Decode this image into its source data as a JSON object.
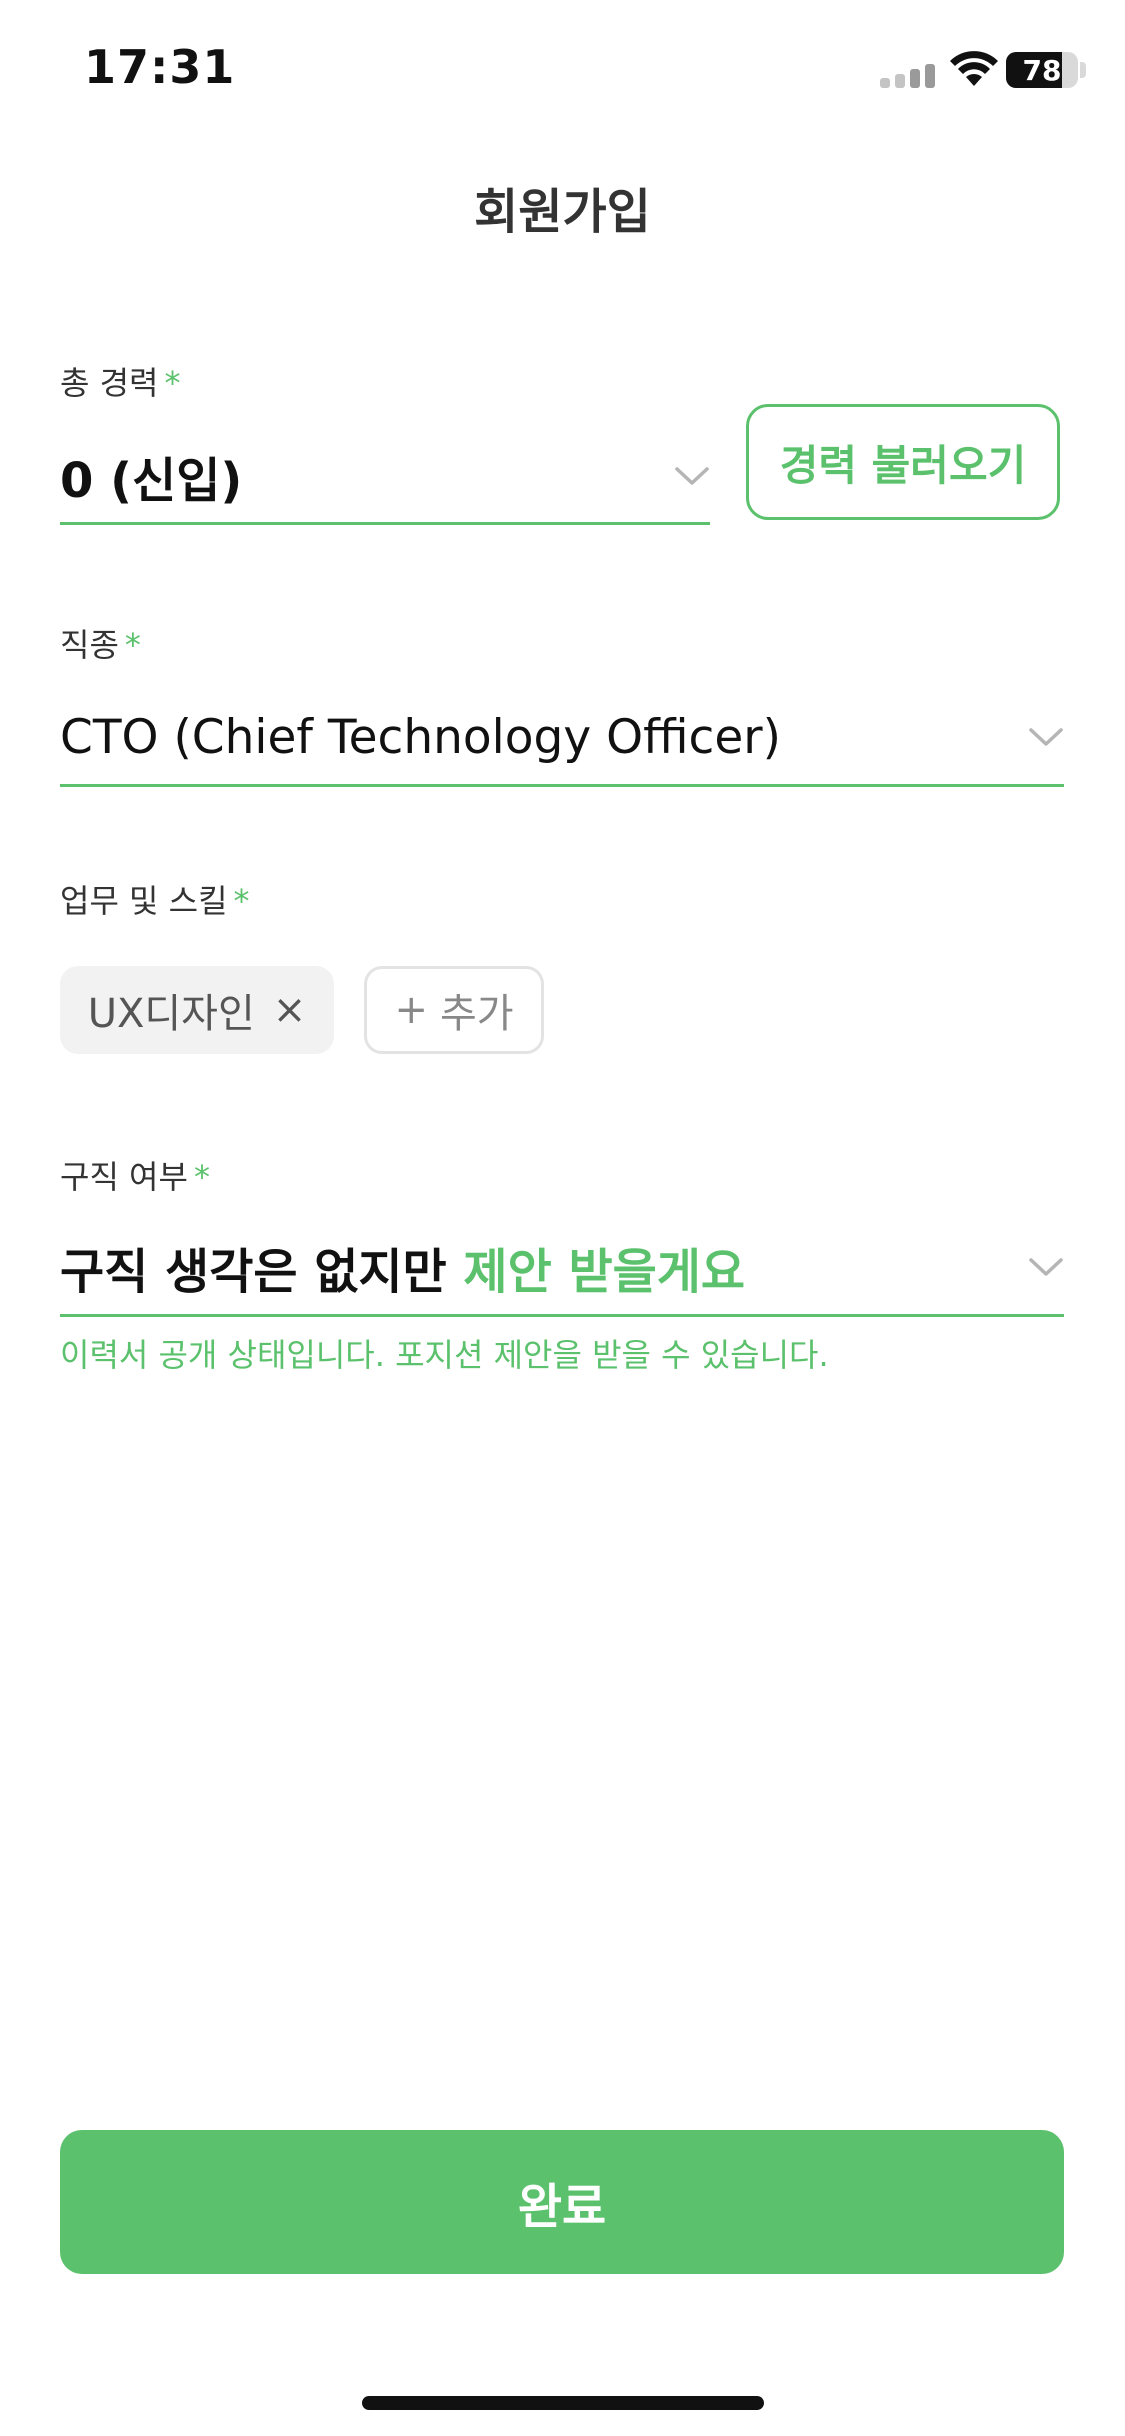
{
  "status_bar": {
    "time": "17:31",
    "battery_level": "78"
  },
  "header": {
    "title": "회원가입"
  },
  "form": {
    "career": {
      "label": "총 경력",
      "required_mark": "*",
      "value": "0 (신입)",
      "load_button": "경력 불러오기"
    },
    "job": {
      "label": "직종",
      "required_mark": "*",
      "value": "CTO (Chief Technology Officer)"
    },
    "skills": {
      "label": "업무 및 스킬",
      "required_mark": "*",
      "chips": [
        "UX디자인"
      ],
      "chip_remove": "×",
      "add_icon": "+",
      "add_label": "추가"
    },
    "job_seeking": {
      "label": "구직 여부",
      "required_mark": "*",
      "value_prefix": "구직 생각은 없지만 ",
      "value_highlight": "제안 받을게요",
      "helper": "이력서 공개 상태입니다. 포지션 제안을 받을 수 있습니다."
    }
  },
  "footer": {
    "submit_label": "완료"
  },
  "colors": {
    "accent": "#5bc16c",
    "text": "#111111",
    "label": "#333333"
  },
  "icons": {
    "signal": "cellular-signal-icon",
    "wifi": "wifi-icon",
    "battery": "battery-icon",
    "dropdown": "chevron-down-icon",
    "remove": "close-icon",
    "add": "plus-icon"
  }
}
